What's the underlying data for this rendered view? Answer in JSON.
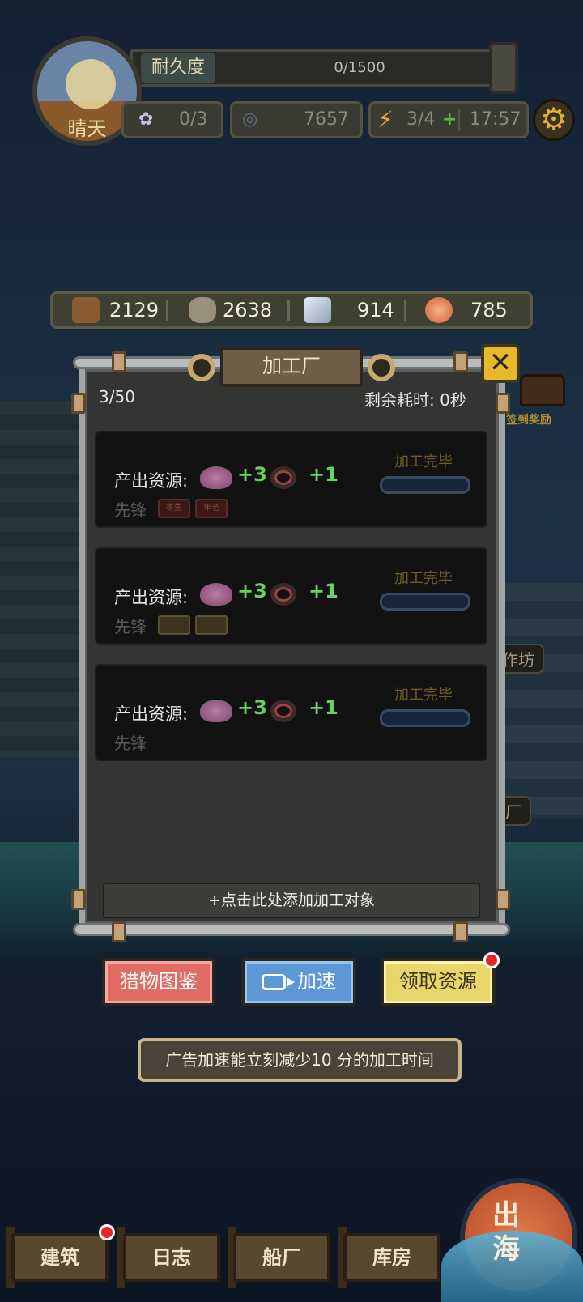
{
  "hud": {
    "weather": "晴天",
    "durability_label": "耐久度",
    "durability_value": "0/1500",
    "flower_count": "0/3",
    "coin_count": "7657",
    "energy": "3/4",
    "energy_timer": "17:57"
  },
  "resources": {
    "wood": "2129",
    "stone": "2638",
    "iron": "914",
    "meat": "785"
  },
  "panel": {
    "title": "加工厂",
    "capacity": "3/50",
    "remaining_time": "剩余耗时: 0秒",
    "rows": [
      {
        "label": "产出资源:",
        "amount1": "+3",
        "amount2": "+1",
        "vanguard": "先锋",
        "status": "加工完毕",
        "tag1": "寄生",
        "tag2": "年老"
      },
      {
        "label": "产出资源:",
        "amount1": "+3",
        "amount2": "+1",
        "vanguard": "先锋",
        "status": "加工完毕"
      },
      {
        "label": "产出资源:",
        "amount1": "+3",
        "amount2": "+1",
        "vanguard": "先锋",
        "status": "加工完毕"
      }
    ],
    "add_button": "+点击此处添加加工对象"
  },
  "buttons": {
    "catalog": "猎物图鉴",
    "speedup": "加速",
    "collect": "领取资源"
  },
  "tip": "广告加速能立刻减少10 分的加工时间",
  "background_labels": {
    "workshop": "作坊",
    "shipyard_partial": "船厂",
    "signin_reward": "签到奖励"
  },
  "nav": {
    "build": "建筑",
    "log": "日志",
    "shipyard": "船厂",
    "storage": "库房",
    "sail": "出海"
  },
  "colors": {
    "accent_green": "#66d35c",
    "close_yellow": "#e7b92a",
    "btn_red": "#e06c63",
    "btn_blue": "#5e97d6",
    "btn_yellow": "#e8d66a",
    "notify_red": "#e0282a"
  }
}
